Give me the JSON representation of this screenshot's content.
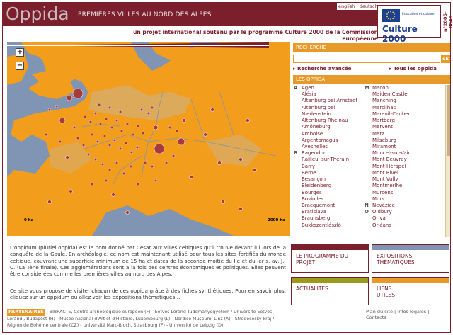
{
  "header": {
    "logo": "Oppida",
    "tagline": "PREMIÈRES VILLES AU NORD DES ALPES",
    "languages": [
      "english",
      "deutsch"
    ],
    "subtitle": "un projet international soutenu par le programme Culture 2000 de la Commission européenne",
    "eu_small_text": "Education et culture",
    "eu_logo_text": "Culture 2000",
    "agreement_number": "n°2005-0840"
  },
  "map": {
    "zoom_in": "+",
    "zoom_out": "−",
    "scale_start": "0 ha",
    "scale_end": "2000 ha",
    "colors": {
      "sea": "#7f95b3",
      "land": "#f29d1c",
      "lowland": "#c9b48e",
      "site": "#a73a3a"
    }
  },
  "search": {
    "header": "RECHERCHE",
    "placeholder": "",
    "ok_label": "ok",
    "advanced_link": "▸ Recherche avancée",
    "all_link": "▸ Tous les oppida"
  },
  "oppida": {
    "header": "LES OPPIDA",
    "column_a": [
      {
        "letter": "A",
        "name": "Agen"
      },
      {
        "letter": "",
        "name": "Alésia"
      },
      {
        "letter": "",
        "name": "Altenburg bei Arnstadt"
      },
      {
        "letter": "",
        "name": "Altenburg bei Niedenstein"
      },
      {
        "letter": "",
        "name": "Altenburg-Rheinau"
      },
      {
        "letter": "",
        "name": "Amöneburg"
      },
      {
        "letter": "",
        "name": "Amboise"
      },
      {
        "letter": "",
        "name": "Argentomagus"
      },
      {
        "letter": "",
        "name": "Avesnelles"
      },
      {
        "letter": "B",
        "name": "Ragendon"
      },
      {
        "letter": "",
        "name": "Railleul-sur-Thérain"
      },
      {
        "letter": "",
        "name": "Barry"
      },
      {
        "letter": "",
        "name": "Berne"
      },
      {
        "letter": "",
        "name": "Besançon"
      },
      {
        "letter": "",
        "name": "Bleidenberg"
      },
      {
        "letter": "",
        "name": "Bourges"
      },
      {
        "letter": "",
        "name": "Boviolles"
      },
      {
        "letter": "",
        "name": "Bracquemont"
      },
      {
        "letter": "",
        "name": "Bratislava"
      },
      {
        "letter": "",
        "name": "Braunsberg"
      },
      {
        "letter": "",
        "name": "Bukkszentlászló"
      }
    ],
    "column_b": [
      {
        "letter": "M",
        "name": "Macon"
      },
      {
        "letter": "",
        "name": "Maiden Castle"
      },
      {
        "letter": "",
        "name": "Manching"
      },
      {
        "letter": "",
        "name": "Marcilhac"
      },
      {
        "letter": "",
        "name": "Mareuil-Caubert"
      },
      {
        "letter": "",
        "name": "Martberg"
      },
      {
        "letter": "",
        "name": "Mervent"
      },
      {
        "letter": "",
        "name": "Metz"
      },
      {
        "letter": "",
        "name": "Milseburg"
      },
      {
        "letter": "",
        "name": "Miramont"
      },
      {
        "letter": "",
        "name": "Moncel-sur-Vair"
      },
      {
        "letter": "",
        "name": "Mont Beuvray"
      },
      {
        "letter": "",
        "name": "Mont-Hérapel"
      },
      {
        "letter": "",
        "name": "Mont Rivel"
      },
      {
        "letter": "",
        "name": "Mont Vully"
      },
      {
        "letter": "",
        "name": "Montmerlhe"
      },
      {
        "letter": "",
        "name": "Murcens"
      },
      {
        "letter": "",
        "name": "Murs"
      },
      {
        "letter": "N",
        "name": "Nevézice"
      },
      {
        "letter": "O",
        "name": "Oldbury"
      },
      {
        "letter": "",
        "name": "Orival"
      },
      {
        "letter": "",
        "name": "Orléans"
      }
    ]
  },
  "intro": {
    "paragraph1": "L'oppidum (pluriel oppida) est le nom donné par César aux villes celtiques qu'il trouve devant lui lors de la conquête de la Gaule. En archéologie, ce nom est maintenant utilisé pour tous les sites fortifiés du monde celtique, couvrant une superficie minimum de 15 ha et datés de la seconde moitié du IIe et du Ier s. av. J.-C. (La Tène finale). Ces agglomérations sont à la fois des centres économiques et politiques. Elles peuvent être considérées comme les premières villes au nord des Alpes.",
    "paragraph2": "Ce site vous propose de visiter chacun de ces oppida grâce à des fiches synthétiques. Pour en savoir plus, cliquez sur un oppidum ou allez voir les expositions thématiques…"
  },
  "tiles": [
    {
      "label": "LE PROGRAMME DU PROJET",
      "cap_color": "#7a1f2b"
    },
    {
      "label": "EXPOSITIONS THÉMATIQUES",
      "cap_color": "#7f95b3"
    },
    {
      "label": "ACTUALITÉS",
      "cap_color": "#9b9a1a"
    },
    {
      "label": "LIENS UTILES",
      "cap_color": "#e79a2a"
    }
  ],
  "footer": {
    "partners_label": "PARTENAIRES",
    "partners_text": ": BIBRACTE, Centre archéologique européen (F) - Eötvös Loránd Tudományegyetem / Université Eötvös Loránd , Budapest (H) - Musée national d'Art et d'Histoire, Luxembourg (L) - Nordico Museum, Linz (A) - Středočeský kraj / Région de Bohême centrale (CZ) - Université Marc-Bloch, Strasbourg (F) - Université de Leipzig (D)",
    "links": [
      "Plan du site",
      "Infos légales",
      "Contacts"
    ]
  }
}
